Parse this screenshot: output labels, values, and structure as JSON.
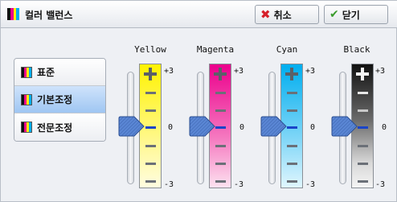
{
  "header": {
    "title": "컬러 밸런스",
    "cancel_label": "취소",
    "close_label": "닫기"
  },
  "modes": [
    {
      "label": "표준",
      "selected": false
    },
    {
      "label": "기본조정",
      "selected": true
    },
    {
      "label": "전문조정",
      "selected": false
    }
  ],
  "channels": [
    {
      "name": "Yellow",
      "value": 0,
      "max": "+3",
      "zero": "0",
      "min": "-3"
    },
    {
      "name": "Magenta",
      "value": 0,
      "max": "+3",
      "zero": "0",
      "min": "-3"
    },
    {
      "name": "Cyan",
      "value": 0,
      "max": "+3",
      "zero": "0",
      "min": "-3"
    },
    {
      "name": "Black",
      "value": 0,
      "max": "+3",
      "zero": "0",
      "min": "-3"
    }
  ],
  "colors": {
    "yellow": "#fff200",
    "magenta": "#ec008c",
    "cyan": "#00aeef",
    "black": "#111111",
    "selected_mode": "#9fc6f2",
    "knob": "#4a78c8"
  },
  "icons": {
    "title": "color-bars-icon",
    "cancel": "cross-icon",
    "close": "checkmark-icon"
  }
}
